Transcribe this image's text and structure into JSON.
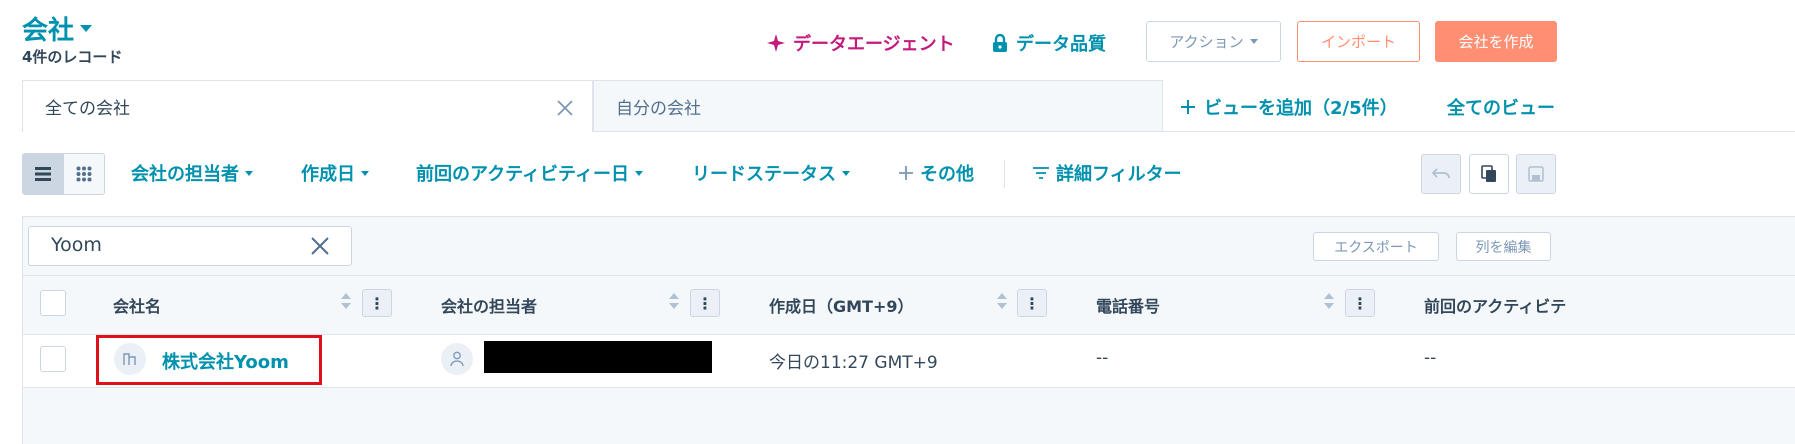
{
  "header": {
    "object_title": "会社",
    "record_count": "4件のレコード",
    "data_agent_label": "データエージェント",
    "data_quality_label": "データ品質",
    "actions_label": "アクション",
    "import_label": "インポート",
    "create_label": "会社を作成",
    "colors": {
      "teal": "#0091ae",
      "magenta": "#c4197d",
      "orange": "#ff7a59"
    }
  },
  "views": {
    "tabs": [
      {
        "label": "全ての会社",
        "active": true
      },
      {
        "label": "自分の会社",
        "active": false
      }
    ],
    "add_view_label": "ビューを追加（2/5件）",
    "all_views_label": "全てのビュー"
  },
  "filters": {
    "owner": "会社の担当者",
    "created": "作成日",
    "last_activity": "前回のアクティビティー日",
    "lead_status": "リードステータス",
    "more": "その他",
    "advanced": "詳細フィルター"
  },
  "table": {
    "search_value": "Yoom",
    "export_label": "エクスポート",
    "edit_columns_label": "列を編集",
    "columns": [
      "会社名",
      "会社の担当者",
      "作成日（GMT+9）",
      "電話番号",
      "前回のアクティビテ"
    ],
    "rows": [
      {
        "name": "株式会社Yoom",
        "owner": "",
        "created": "今日の11:27 GMT+9",
        "phone": "--",
        "last_activity": "--"
      }
    ]
  }
}
